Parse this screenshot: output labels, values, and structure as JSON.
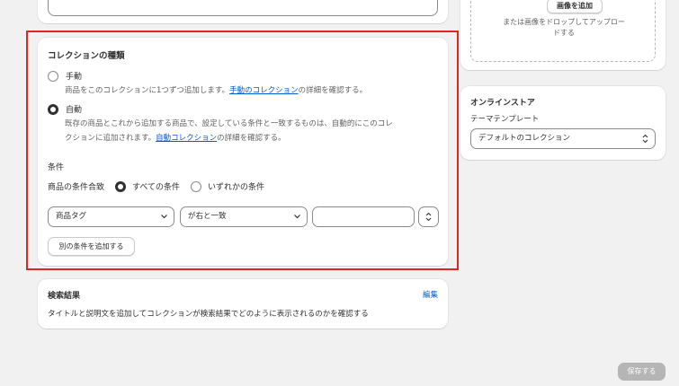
{
  "type_card": {
    "title": "コレクションの種類",
    "manual": {
      "label": "手動",
      "help_before": "商品をこのコレクションに1つずつ追加します。",
      "help_link": "手動のコレクション",
      "help_after": "の詳細を確認する。"
    },
    "auto": {
      "label": "自動",
      "help_line1": "既存の商品とこれから追加する商品で、設定している条件と一致するものは、自動的にこのコレ",
      "help_line2_before": "クションに追加されます。",
      "help_link": "自動コレクション",
      "help_after": "の詳細を確認する。"
    },
    "conditions": {
      "title": "条件",
      "match_label": "商品の条件合致",
      "match_all": "すべての条件",
      "match_any": "いずれかの条件",
      "field_select": "商品タグ",
      "operator_select": "が右と一致",
      "value_input": "",
      "add_button": "別の条件を追加する"
    }
  },
  "seo": {
    "title": "検索結果",
    "edit_link": "編集",
    "description": "タイトルと説明文を追加してコレクションが検索結果でどのように表示されるのかを確認する"
  },
  "image": {
    "add_button": "画像を追加",
    "drop_hint_line1": "または画像をドロップしてアップロー",
    "drop_hint_line2": "ドする"
  },
  "online_store": {
    "title": "オンラインストア",
    "template_label": "テーマテンプレート",
    "template_value": "デフォルトのコレクション"
  },
  "save_button": "保存する",
  "colors": {
    "background": "#f1f1f1",
    "link": "#005bd3",
    "highlight": "#e02424",
    "disabled_button": "#b5b5b5"
  }
}
